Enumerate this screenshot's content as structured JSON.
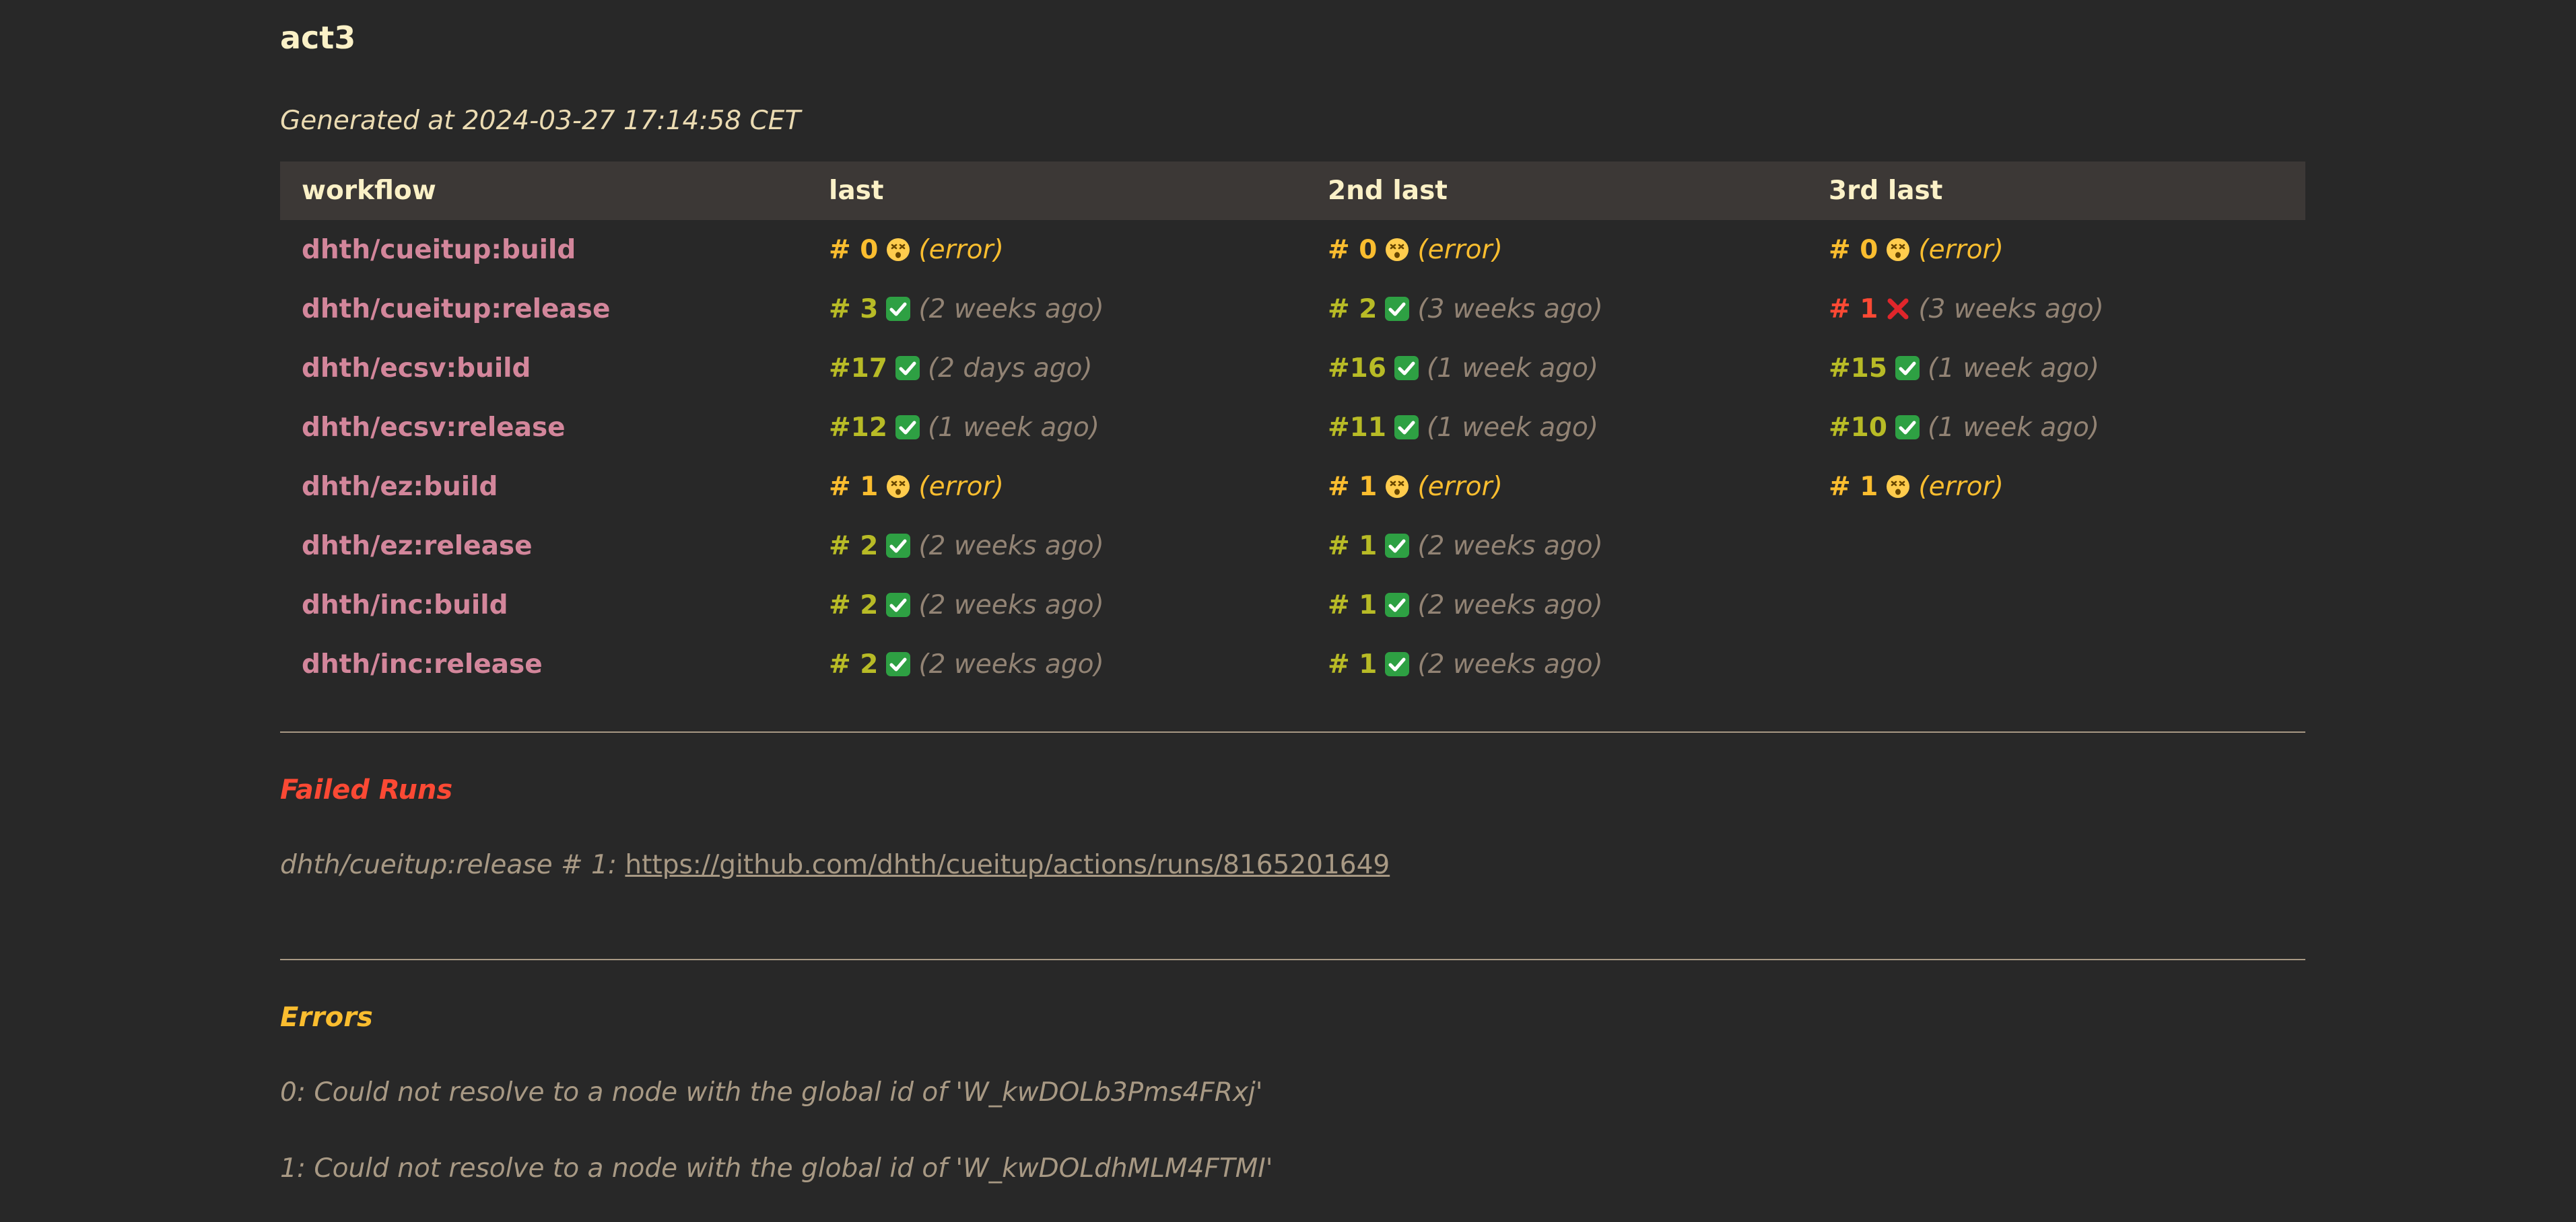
{
  "title": "act3",
  "generated": "Generated at 2024-03-27 17:14:58 CET",
  "table": {
    "headers": [
      "workflow",
      "last",
      "2nd last",
      "3rd last"
    ],
    "rows": [
      {
        "workflow": "dhth/cueitup:build",
        "runs": [
          {
            "num": "# 0",
            "status": "error",
            "text": "(error)"
          },
          {
            "num": "# 0",
            "status": "error",
            "text": "(error)"
          },
          {
            "num": "# 0",
            "status": "error",
            "text": "(error)"
          }
        ]
      },
      {
        "workflow": "dhth/cueitup:release",
        "runs": [
          {
            "num": "# 3",
            "status": "success",
            "text": "(2 weeks ago)"
          },
          {
            "num": "# 2",
            "status": "success",
            "text": "(3 weeks ago)"
          },
          {
            "num": "# 1",
            "status": "failure",
            "text": "(3 weeks ago)"
          }
        ]
      },
      {
        "workflow": "dhth/ecsv:build",
        "runs": [
          {
            "num": "#17",
            "status": "success",
            "text": "(2 days ago)"
          },
          {
            "num": "#16",
            "status": "success",
            "text": "(1 week ago)"
          },
          {
            "num": "#15",
            "status": "success",
            "text": "(1 week ago)"
          }
        ]
      },
      {
        "workflow": "dhth/ecsv:release",
        "runs": [
          {
            "num": "#12",
            "status": "success",
            "text": "(1 week ago)"
          },
          {
            "num": "#11",
            "status": "success",
            "text": "(1 week ago)"
          },
          {
            "num": "#10",
            "status": "success",
            "text": "(1 week ago)"
          }
        ]
      },
      {
        "workflow": "dhth/ez:build",
        "runs": [
          {
            "num": "# 1",
            "status": "error",
            "text": "(error)"
          },
          {
            "num": "# 1",
            "status": "error",
            "text": "(error)"
          },
          {
            "num": "# 1",
            "status": "error",
            "text": "(error)"
          }
        ]
      },
      {
        "workflow": "dhth/ez:release",
        "runs": [
          {
            "num": "# 2",
            "status": "success",
            "text": "(2 weeks ago)"
          },
          {
            "num": "# 1",
            "status": "success",
            "text": "(2 weeks ago)"
          }
        ]
      },
      {
        "workflow": "dhth/inc:build",
        "runs": [
          {
            "num": "# 2",
            "status": "success",
            "text": "(2 weeks ago)"
          },
          {
            "num": "# 1",
            "status": "success",
            "text": "(2 weeks ago)"
          }
        ]
      },
      {
        "workflow": "dhth/inc:release",
        "runs": [
          {
            "num": "# 2",
            "status": "success",
            "text": "(2 weeks ago)"
          },
          {
            "num": "# 1",
            "status": "success",
            "text": "(2 weeks ago)"
          }
        ]
      }
    ]
  },
  "failed_runs": {
    "title": "Failed Runs",
    "items": [
      {
        "label": "dhth/cueitup:release # 1: ",
        "url": "https://github.com/dhth/cueitup/actions/runs/8165201649"
      }
    ]
  },
  "errors": {
    "title": "Errors",
    "items": [
      "0: Could not resolve to a node with the global id of 'W_kwDOLb3Pms4FRxj'",
      "1: Could not resolve to a node with the global id of 'W_kwDOLdhMLM4FTMI'"
    ]
  },
  "colors": {
    "background": "#282828",
    "workflow_link": "#d3869b",
    "success": "#b8bb26",
    "error": "#fabd2f",
    "failure": "#fb4934",
    "muted": "#928374",
    "failed_title": "#fb4934",
    "errors_title": "#fabd2f"
  },
  "icons": {
    "success": "check-mark-icon",
    "failure": "cross-mark-icon",
    "error": "dizzy-face-icon"
  }
}
